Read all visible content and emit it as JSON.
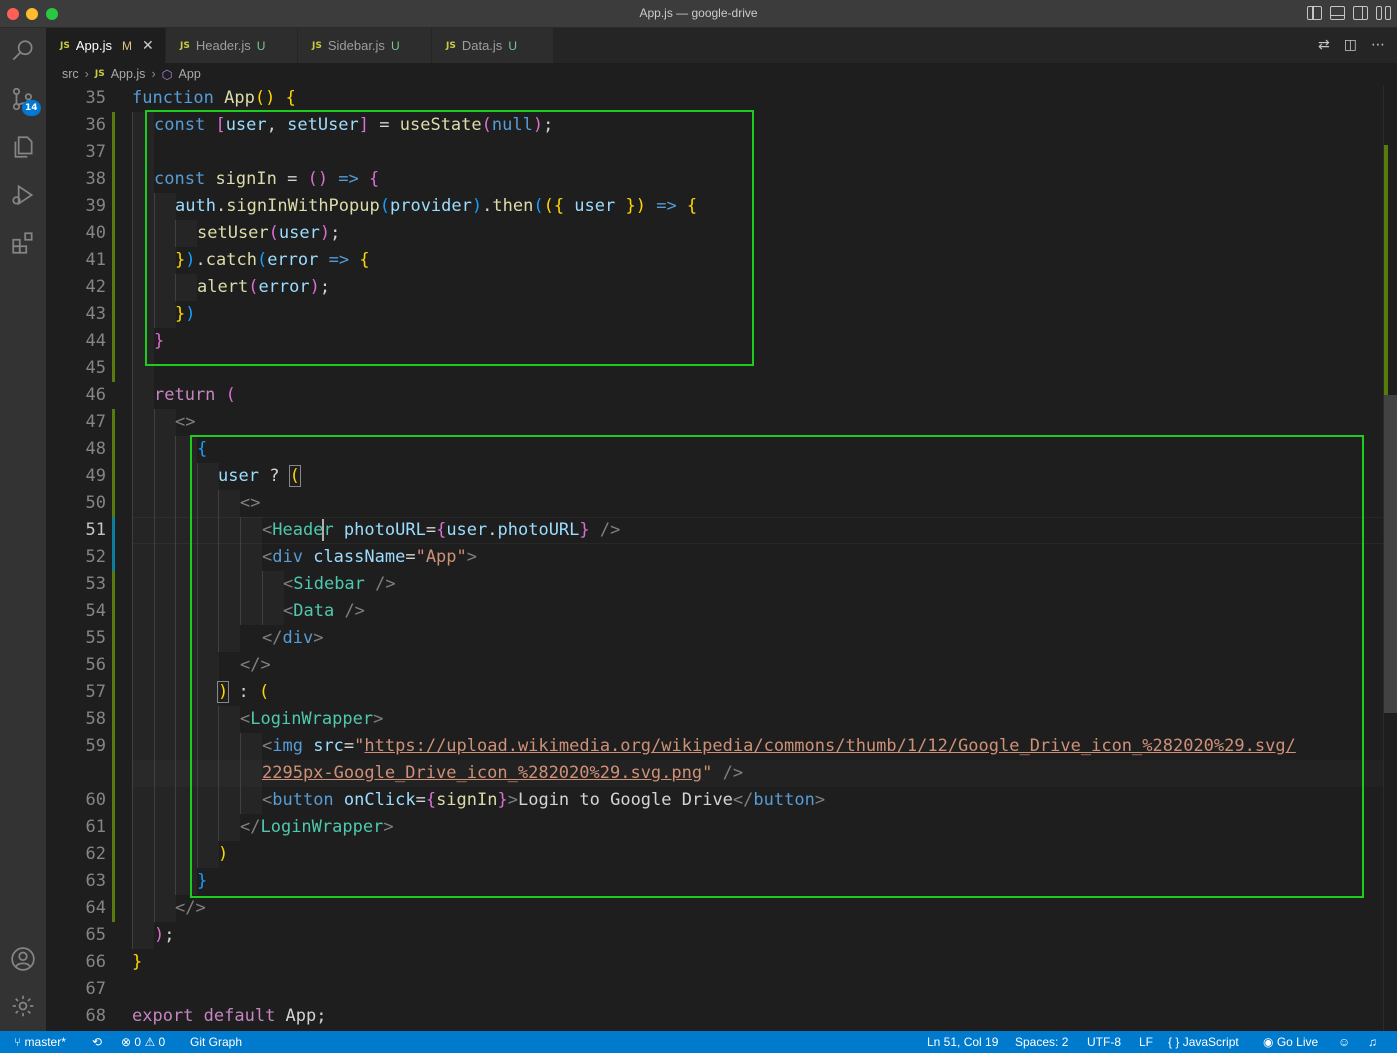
{
  "window": {
    "title": "App.js — google-drive"
  },
  "activity": {
    "scm_badge": "14"
  },
  "tabs": [
    {
      "label": "App.js",
      "status": "M"
    },
    {
      "label": "Header.js",
      "status": "U"
    },
    {
      "label": "Sidebar.js",
      "status": "U"
    },
    {
      "label": "Data.js",
      "status": "U"
    }
  ],
  "file_icon": "JS",
  "breadcrumb": {
    "folder": "src",
    "file": "App.js",
    "symbol": "App"
  },
  "editor": {
    "line_numbers": [
      "35",
      "36",
      "37",
      "38",
      "39",
      "40",
      "41",
      "42",
      "43",
      "44",
      "45",
      "46",
      "47",
      "48",
      "49",
      "50",
      "51",
      "52",
      "53",
      "54",
      "55",
      "56",
      "57",
      "58",
      "59",
      "60",
      "61",
      "62",
      "63",
      "64",
      "65",
      "66",
      "67",
      "68"
    ],
    "code": {
      "l35": {
        "a": "function",
        "b": "App",
        "c": "()",
        "d": "{"
      },
      "l36": {
        "a": "const",
        "b": "[",
        "c": "user",
        "d": ", ",
        "e": "setUser",
        "f": "]",
        "g": " = ",
        "h": "useState",
        "i": "(",
        "j": "null",
        "k": ")",
        "l": ";"
      },
      "l38": {
        "a": "const",
        "b": "signIn",
        "c": " = ",
        "d": "()",
        "e": " => ",
        "f": "{"
      },
      "l39": {
        "a": "auth",
        "b": ".",
        "c": "signInWithPopup",
        "d": "(",
        "e": "provider",
        "f": ")",
        "g": ".",
        "h": "then",
        "i": "(",
        "j": "({",
        "k": " user ",
        "l": "})",
        "m": " => ",
        "n": "{"
      },
      "l40": {
        "a": "setUser",
        "b": "(",
        "c": "user",
        "d": ")",
        "e": ";"
      },
      "l41": {
        "a": "}",
        "b": ")",
        "c": ".",
        "d": "catch",
        "e": "(",
        "f": "error",
        "g": " => ",
        "h": "{"
      },
      "l42": {
        "a": "alert",
        "b": "(",
        "c": "error",
        "d": ")",
        "e": ";"
      },
      "l43": {
        "a": "}",
        "b": ")"
      },
      "l44": {
        "a": "}"
      },
      "l46": {
        "a": "return",
        "b": "("
      },
      "l47": {
        "a": "<>"
      },
      "l48": {
        "a": "{"
      },
      "l49": {
        "a": "user",
        "b": " ? ",
        "c": "("
      },
      "l50": {
        "a": "<>"
      },
      "l51": {
        "a": "<",
        "b": "Heade",
        "c": "r",
        "d": " photoURL",
        "e": "=",
        "f": "{",
        "g": "user",
        "h": ".",
        "i": "photoURL",
        "j": "}",
        "k": " />"
      },
      "l52": {
        "a": "<",
        "b": "div",
        "c": " className",
        "d": "=",
        "e": "\"App\"",
        "f": ">"
      },
      "l53": {
        "a": "<",
        "b": "Sidebar",
        "c": " />"
      },
      "l54": {
        "a": "<",
        "b": "Data",
        "c": " />"
      },
      "l55": {
        "a": "</",
        "b": "div",
        "c": ">"
      },
      "l56": {
        "a": "</>"
      },
      "l57": {
        "a": ")",
        "b": " : ",
        "c": "("
      },
      "l58": {
        "a": "<",
        "b": "LoginWrapper",
        "c": ">"
      },
      "l59": {
        "a": "<",
        "b": "img",
        "c": " src",
        "d": "=",
        "e": "\"",
        "f": "https://upload.wikimedia.org/wikipedia/commons/thumb/1/12/Google_Drive_icon_%282020%29.svg/",
        "g": "2295px-Google_Drive_icon_%282020%29.svg.png",
        "h": "\"",
        "i": " />"
      },
      "l60": {
        "a": "<",
        "b": "button",
        "c": " onClick",
        "d": "=",
        "e": "{",
        "f": "signIn",
        "g": "}",
        "h": ">",
        "i": "Login to Google Drive",
        "j": "</",
        "k": "button",
        "l": ">"
      },
      "l61": {
        "a": "</",
        "b": "LoginWrapper",
        "c": ">"
      },
      "l62": {
        "a": ")"
      },
      "l63": {
        "a": "}"
      },
      "l64": {
        "a": "</>"
      },
      "l65": {
        "a": ")",
        "b": ";"
      },
      "l66": {
        "a": "}"
      },
      "l68": {
        "a": "export",
        "b": " default ",
        "c": "App",
        "d": ";"
      }
    }
  },
  "statusbar": {
    "branch": "master*",
    "errors": "0",
    "warnings": "0",
    "git_graph": "Git Graph",
    "cursor": "Ln 51, Col 19",
    "spaces": "Spaces: 2",
    "encoding": "UTF-8",
    "eol": "LF",
    "language": "JavaScript",
    "golive": "Go Live"
  },
  "colors": {
    "highlight_box": "#1ecc1e",
    "statusbar": "#007acc",
    "keyword": "#569cd6",
    "function": "#dcdcaa",
    "variable": "#9cdcfe",
    "component": "#4ec9b0",
    "string": "#ce9178"
  }
}
